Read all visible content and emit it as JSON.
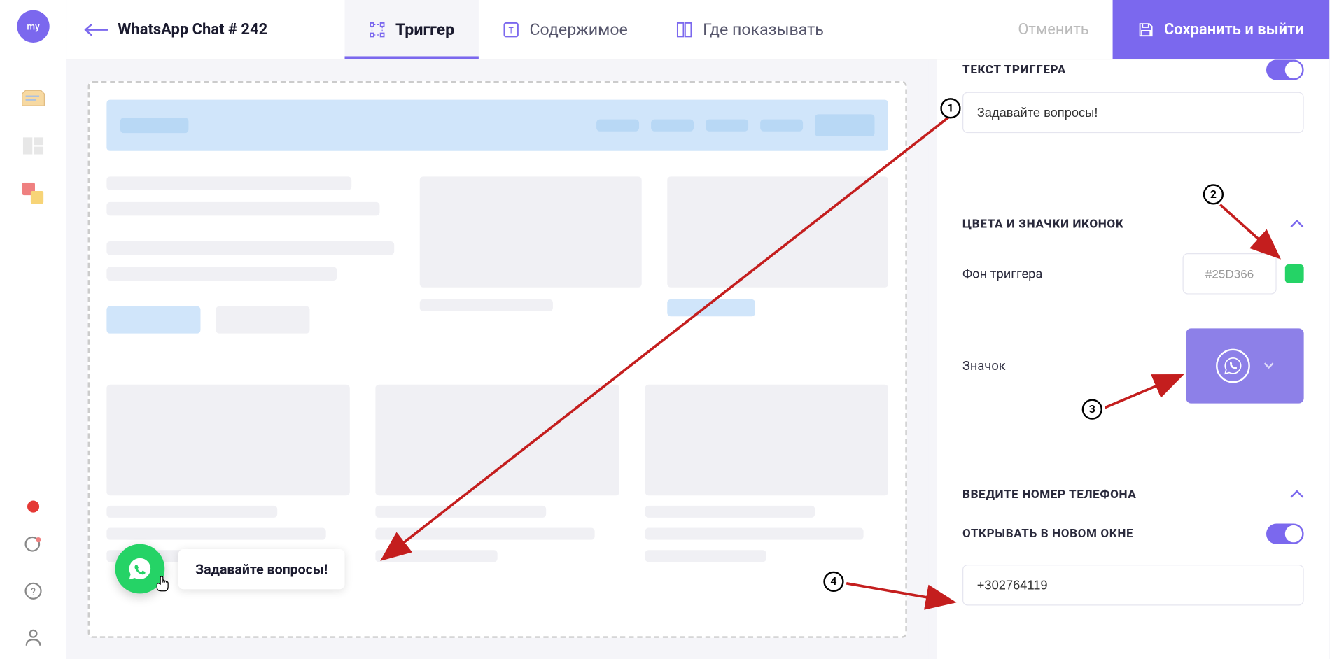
{
  "sidebar": {
    "avatar": "my"
  },
  "header": {
    "title": "WhatsApp Chat # 242",
    "tabs": [
      {
        "label": "Триггер"
      },
      {
        "label": "Содержимое"
      },
      {
        "label": "Где показывать"
      }
    ],
    "cancel": "Отменить",
    "save": "Сохранить и выйти"
  },
  "widget": {
    "label": "Задавайте вопросы!"
  },
  "panel": {
    "trigger_text_title": "ТЕКСТ ТРИГГЕРА",
    "trigger_text_value": "Задавайте вопросы!",
    "colors_title": "ЦВЕТА И ЗНАЧКИ ИКОНОК",
    "bg_label": "Фон триггера",
    "bg_value": "#25D366",
    "icon_label": "Значок",
    "phone_title": "ВВЕДИТЕ НОМЕР ТЕЛЕФОНА",
    "new_window_label": "ОТКРЫВАТЬ В НОВОМ ОКНЕ",
    "phone_value": "+302764119"
  },
  "annotations": {
    "a1": "1",
    "a2": "2",
    "a3": "3",
    "a4": "4"
  }
}
